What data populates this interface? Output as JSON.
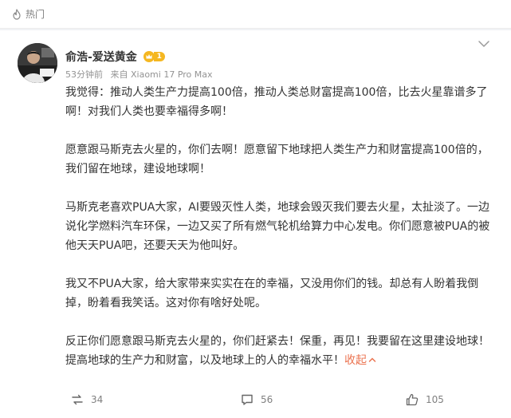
{
  "section": {
    "label": "热门",
    "icon": "flame-icon"
  },
  "post": {
    "username": "俞浩-爱送黄金",
    "badge_level": "1",
    "time": "53分钟前",
    "source": "来自 Xiaomi 17 Pro Max",
    "paragraphs": [
      "我觉得：推动人类生产力提高100倍，推动人类总财富提高100倍，比去火星靠谱多了啊！对我们人类也要幸福得多啊！",
      "愿意跟马斯克去火星的，你们去啊！愿意留下地球把人类生产力和财富提高100倍的，我们留在地球，建设地球啊！",
      "马斯克老喜欢PUA大家，AI要毁灭性人类，地球会毁灭我们要去火星，太扯淡了。一边说化学燃料汽车环保，一边又买了所有燃气轮机给算力中心发电。你们愿意被PUA的被他天天PUA吧，还要天天为他叫好。",
      "我又不PUA大家，给大家带来实实在在的幸福，又没用你们的钱。却总有人盼着我倒掉，盼着看我笑话。这对你有啥好处呢。",
      "反正你们愿意跟马斯克去火星的，你们赶紧去！保重，再见！我要留在这里建设地球！提高地球的生产力和财富，以及地球上的人的幸福水平！"
    ],
    "collapse_label": "收起",
    "reposts": "34",
    "comments": "56",
    "likes": "105"
  },
  "colors": {
    "accent": "#eb7350",
    "badge": "#f5b721",
    "text": "#333333",
    "muted": "#939393"
  }
}
